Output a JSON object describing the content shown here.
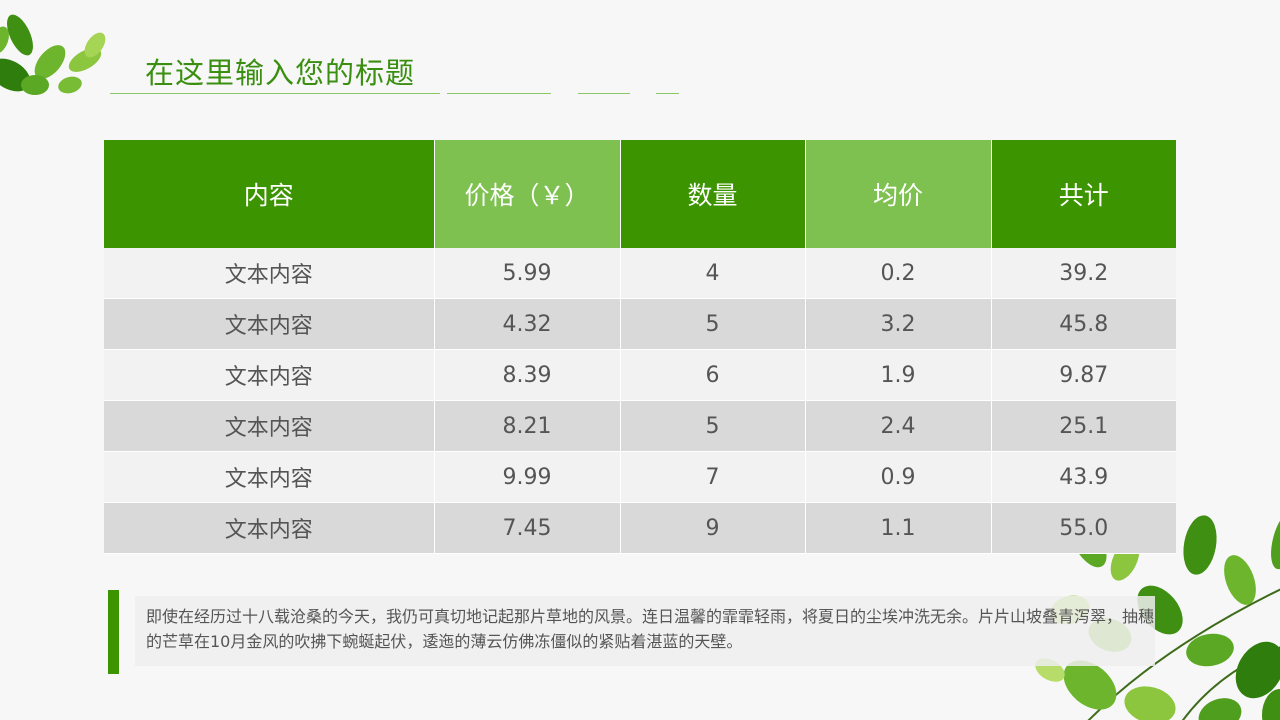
{
  "title": "在这里输入您的标题",
  "table": {
    "headers": [
      "内容",
      "价格（￥）",
      "数量",
      "均价",
      "共计"
    ],
    "rows": [
      [
        "文本内容",
        "5.99",
        "4",
        "0.2",
        "39.2"
      ],
      [
        "文本内容",
        "4.32",
        "5",
        "3.2",
        "45.8"
      ],
      [
        "文本内容",
        "8.39",
        "6",
        "1.9",
        "9.87"
      ],
      [
        "文本内容",
        "8.21",
        "5",
        "2.4",
        "25.1"
      ],
      [
        "文本内容",
        "9.99",
        "7",
        "0.9",
        "43.9"
      ],
      [
        "文本内容",
        "7.45",
        "9",
        "1.1",
        "55.0"
      ]
    ]
  },
  "paragraph": "即使在经历过十八载沧桑的今天，我仍可真切地记起那片草地的风景。连日温馨的霏霏轻雨，将夏日的尘埃冲洗无余。片片山坡叠青泻翠，抽穗的芒草在10月金风的吹拂下蜿蜒起伏，逶迤的薄云仿佛冻僵似的紧贴着湛蓝的天壁。",
  "colors": {
    "accent_dark": "#3c9400",
    "accent_light": "#7fc151",
    "title": "#3a8f10",
    "row_light": "#f2f2f2",
    "row_dark": "#d9d9d9"
  },
  "decorations": [
    "leaves-icon-top-left",
    "leaves-icon-bottom-right"
  ]
}
